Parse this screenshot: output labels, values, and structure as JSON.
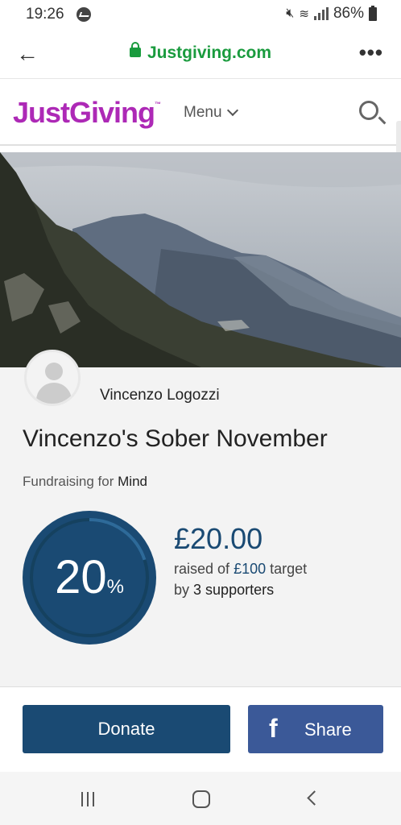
{
  "status_bar": {
    "time": "19:26",
    "battery": "86%"
  },
  "browser": {
    "url": "Justgiving.com",
    "back_icon": "arrow-left-icon",
    "more_icon": "more-dots-icon"
  },
  "site": {
    "logo": "JustGiving",
    "logo_tm": "™",
    "menu_label": "Menu",
    "brand_color": "#ad29b6"
  },
  "page": {
    "owner_name": "Vincenzo Logozzi",
    "title": "Vincenzo's Sober November",
    "fundraising_prefix": "Fundraising for",
    "charity": "Mind",
    "progress_fraction": 0.2,
    "percent_number": "20",
    "percent_sign": "%",
    "amount_raised": "£20.00",
    "raised_prefix": "raised of",
    "target": "£100",
    "raised_suffix": "target",
    "by_prefix": "by",
    "supporters": "3 supporters"
  },
  "actions": {
    "donate_label": "Donate",
    "share_label": "Share",
    "share_icon": "facebook-icon"
  },
  "colors": {
    "primary": "#1a4a73",
    "facebook": "#3b5998",
    "url_green": "#1a9b3e"
  }
}
